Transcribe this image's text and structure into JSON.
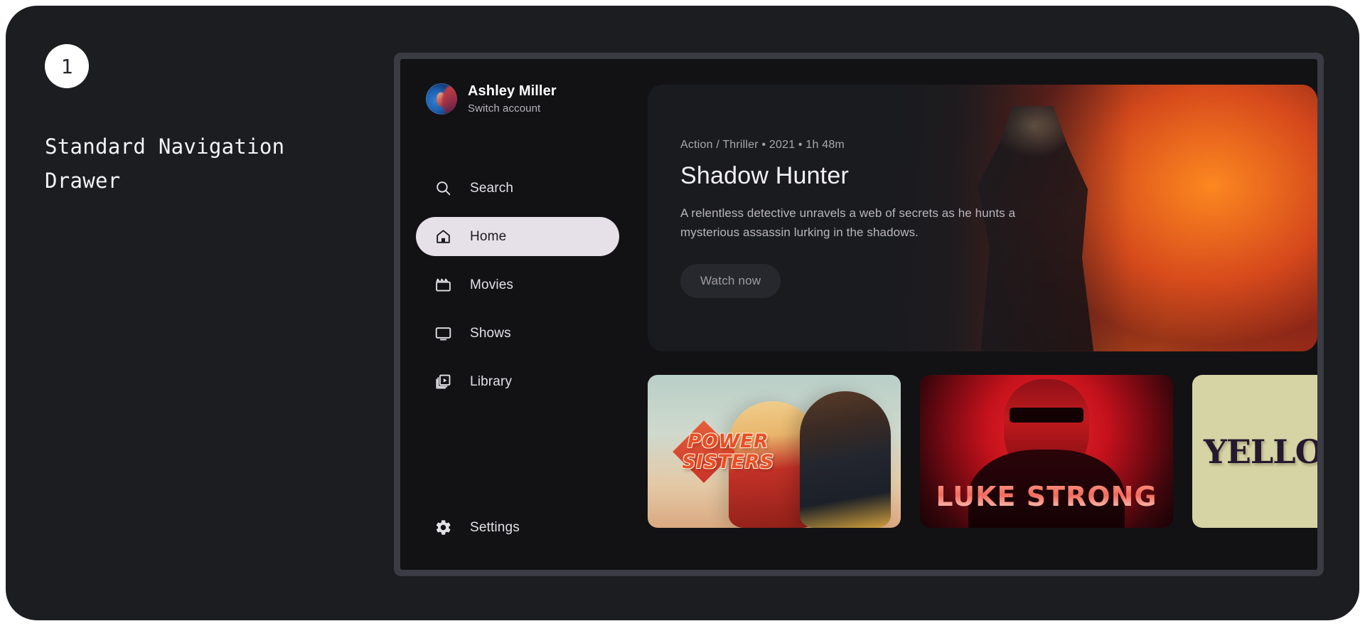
{
  "annotation": {
    "step_number": "1",
    "title": "Standard Navigation\nDrawer"
  },
  "drawer": {
    "account": {
      "name": "Ashley Miller",
      "switch_label": "Switch account",
      "avatar_icon": "user-avatar"
    },
    "items": [
      {
        "label": "Search",
        "icon": "search-icon",
        "active": false
      },
      {
        "label": "Home",
        "icon": "home-icon",
        "active": true
      },
      {
        "label": "Movies",
        "icon": "clapperboard-icon",
        "active": false
      },
      {
        "label": "Shows",
        "icon": "tv-icon",
        "active": false
      },
      {
        "label": "Library",
        "icon": "video-library-icon",
        "active": false
      }
    ],
    "bottom_item": {
      "label": "Settings",
      "icon": "gear-icon",
      "active": false
    }
  },
  "hero": {
    "meta": "Action / Thriller • 2021 • 1h 48m",
    "title": "Shadow Hunter",
    "description": "A relentless detective unravels a web of secrets as he hunts a mysterious assassin lurking in the shadows.",
    "watch_button": "Watch now",
    "artwork_alt": "caped-hero-artwork"
  },
  "cards": [
    {
      "title_line1": "POWER",
      "title_line2": "SISTERS",
      "art": "two-superheroines-poster"
    },
    {
      "title": "LUKE STRONG",
      "art": "red-action-hero-poster"
    },
    {
      "title": "YELLOW",
      "art": "khaki-serif-poster"
    }
  ],
  "colors": {
    "canvas_bg": "#1c1d20",
    "device_bezel": "#3b3b44",
    "screen_bg": "#121214",
    "hero_panel": "#1a1b1f",
    "active_pill": "#e6e0e9",
    "active_pill_text": "#1b1b1f",
    "nav_text": "#e3e1e6",
    "muted_text": "#b7b3bb"
  }
}
